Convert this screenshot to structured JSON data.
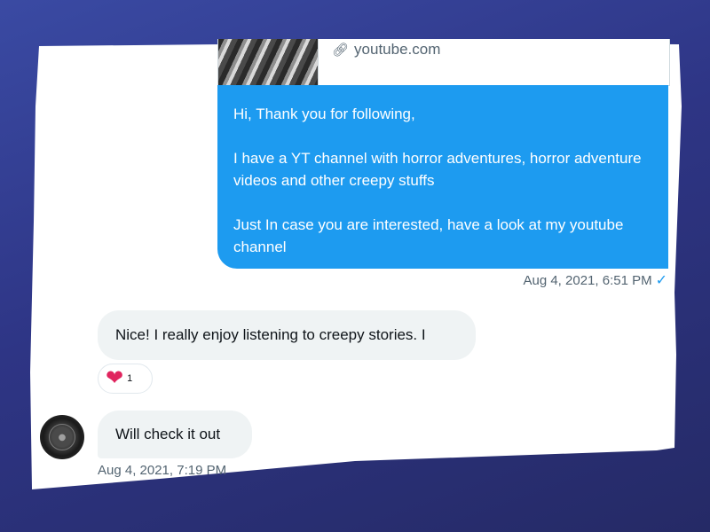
{
  "link_preview": {
    "domain": "youtube.com",
    "link_icon": "link-icon",
    "thumbnail": "video-thumbnail"
  },
  "outgoing": {
    "paragraphs": [
      "Hi, Thank you for following,",
      "I have a YT channel with horror adventures, horror adventure videos and other creepy stuffs",
      "Just In case you are interested, have a look at my youtube channel"
    ],
    "timestamp": "Aug 4, 2021, 6:51 PM",
    "status_icon": "checkmark-icon",
    "bubble_color": "#1d9bf0"
  },
  "incoming": [
    {
      "text": "Nice! I really enjoy listening to creepy stories. I",
      "reaction": {
        "emoji_icon": "heart-icon",
        "count": "1"
      }
    },
    {
      "text": "Will check it out",
      "timestamp": "Aug 4, 2021, 7:19 PM"
    }
  ],
  "colors": {
    "background_start": "#3a4aa3",
    "background_end": "#252a66",
    "heart": "#e0245e",
    "meta_text": "#536471",
    "incoming_bubble": "#eff3f4"
  }
}
